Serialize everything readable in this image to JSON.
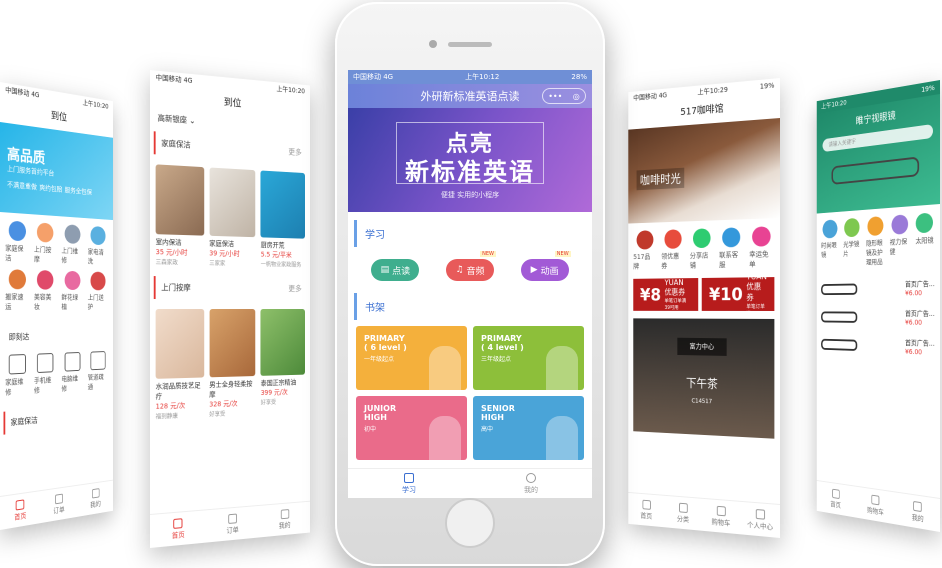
{
  "panel_left1": {
    "status": {
      "carrier": "中国移动 4G",
      "time": "上午10:20"
    },
    "title": "到位",
    "banner": {
      "headline": "高品质",
      "sub": "上门服务首约平台",
      "badges": [
        "不满意重做",
        "爽约包赔",
        "服务全包保"
      ]
    },
    "grid": [
      "家庭保洁",
      "上门按摩",
      "上门维修",
      "家电清洗",
      "搬家速运",
      "美容美妆",
      "鲜花绿植",
      "上门送护"
    ],
    "quick_title": "即刻达",
    "quick": [
      "家庭维修",
      "手机维修",
      "电脑维修",
      "管道疏通"
    ],
    "bottom_section": "家庭保洁",
    "tabs": [
      "首页",
      "订单",
      "我的"
    ]
  },
  "panel_left2": {
    "status": {
      "carrier": "中国移动 4G",
      "time": "上午10:20"
    },
    "title": "到位",
    "location": "高新银座",
    "sections": [
      {
        "title": "家庭保洁",
        "more": "更多",
        "items": [
          {
            "name": "室内保洁",
            "price": "35 元/小时",
            "shop": "三森家政"
          },
          {
            "name": "家庭保洁",
            "price": "39 元/小时",
            "shop": "三家家"
          },
          {
            "name": "厨房开荒",
            "price": "5.5 元/平米",
            "shop": "一帆物业家政服务"
          }
        ]
      },
      {
        "title": "上门按摩",
        "more": "更多",
        "items": [
          {
            "name": "水润品质技艺足疗",
            "price": "128 元/次",
            "shop": "福到静康"
          },
          {
            "name": "男士全身轻柔按摩",
            "price": "328 元/次",
            "shop": "好享受"
          },
          {
            "name": "泰国正宗精油",
            "price": "399 元/次",
            "shop": "好享受"
          }
        ]
      }
    ],
    "tabs": [
      "首页",
      "订单",
      "我的"
    ]
  },
  "phone": {
    "status": {
      "carrier": "中国移动 4G",
      "time": "上午10:12",
      "battery": "28%"
    },
    "title": "外研新标准英语点读",
    "capsule": [
      "•••",
      "◎"
    ],
    "banner": {
      "line1": "点亮",
      "line2": "新标准英语",
      "tagline": "便捷 实用的小程序"
    },
    "study_heading": "学习",
    "buttons": [
      {
        "label": "点读",
        "color": "#3fae8e",
        "tag": ""
      },
      {
        "label": "音频",
        "color": "#e85a5a",
        "tag": "NEW"
      },
      {
        "label": "动画",
        "color": "#a25ad6",
        "tag": "NEW"
      }
    ],
    "shelf_heading": "书架",
    "books": [
      {
        "title": "PRIMARY",
        "level": "( 6 level )",
        "sub": "一年级起点",
        "color": "#f4b03c"
      },
      {
        "title": "PRIMARY",
        "level": "( 4 level )",
        "sub": "三年级起点",
        "color": "#8dbf3a"
      },
      {
        "title": "JUNIOR",
        "level": "HIGH",
        "sub": "初中",
        "color": "#ea6b8a"
      },
      {
        "title": "SENIOR",
        "level": "HIGH",
        "sub": "高中",
        "color": "#4aa4d8"
      }
    ],
    "tabs": [
      "学习",
      "我的"
    ]
  },
  "panel_right1": {
    "status": {
      "carrier": "中国移动 4G",
      "time": "上午10:29",
      "battery": "19%"
    },
    "title": "517咖啡馆",
    "banner_text": "咖啡时光",
    "grid": [
      "517品牌",
      "领优惠券",
      "分享店铺",
      "联系客服",
      "幸运免单"
    ],
    "coupons": [
      {
        "amount": "¥8",
        "unit": "YUAN",
        "label": "优惠券",
        "cond": "单笔订单满39可用"
      },
      {
        "amount": "¥10",
        "unit": "YUAN",
        "label": "优惠券",
        "cond": "单笔订单满49可用"
      }
    ],
    "feature": {
      "heading": "富力中心",
      "name": "下午茶",
      "code": "C14517"
    },
    "tabs": [
      "首页",
      "分类",
      "购物车",
      "个人中心"
    ]
  },
  "panel_right2": {
    "status": {
      "time": "上午10:20",
      "battery": "19%"
    },
    "title": "睢宁视眼镜",
    "search_placeholder": "请输入关键字",
    "grid": [
      "时尚眼镜",
      "光学镜片",
      "隐形眼镜及护理用品",
      "视力保健",
      "太阳镜"
    ],
    "products": [
      {
        "name": "首页广告...",
        "price": "¥6.00"
      },
      {
        "name": "首页广告...",
        "price": "¥6.00"
      },
      {
        "name": "首页广告...",
        "price": "¥6.00"
      }
    ],
    "tabs": [
      "首页",
      "购物车",
      "我的"
    ]
  }
}
